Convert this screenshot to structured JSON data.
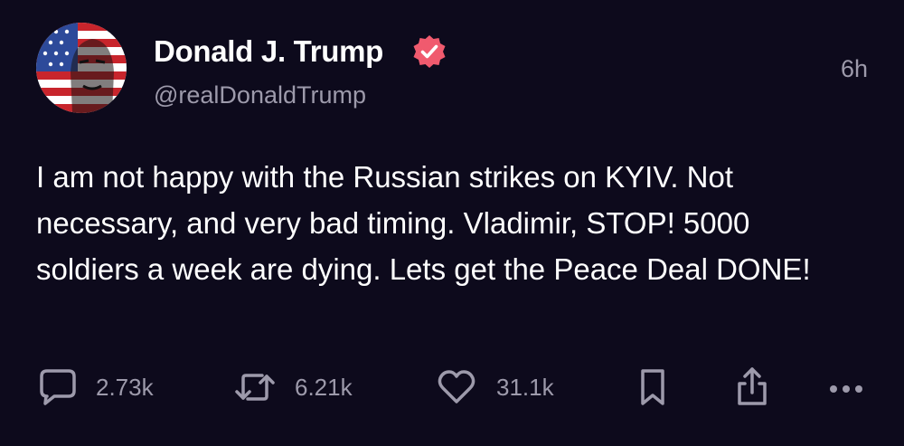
{
  "author": {
    "display_name": "Donald J. Trump",
    "handle": "@realDonaldTrump",
    "verified": true,
    "verified_badge_color": "#f05a6e"
  },
  "timestamp": "6h",
  "post": {
    "text": "I am not happy with the Russian strikes on KYIV. Not necessary, and very bad timing. Vladimir, STOP! 5000 soldiers a week are dying. Lets get the Peace Deal DONE!"
  },
  "actions": {
    "reply": {
      "icon": "comment-icon",
      "count": "2.73k"
    },
    "repost": {
      "icon": "repost-icon",
      "count": "6.21k"
    },
    "like": {
      "icon": "heart-icon",
      "count": "31.1k"
    },
    "bookmark": {
      "icon": "bookmark-icon"
    },
    "share": {
      "icon": "share-icon"
    },
    "more": {
      "icon": "more-icon"
    }
  },
  "colors": {
    "background": "#0d0a1c",
    "text_primary": "#ffffff",
    "text_secondary": "#9d9aab"
  }
}
